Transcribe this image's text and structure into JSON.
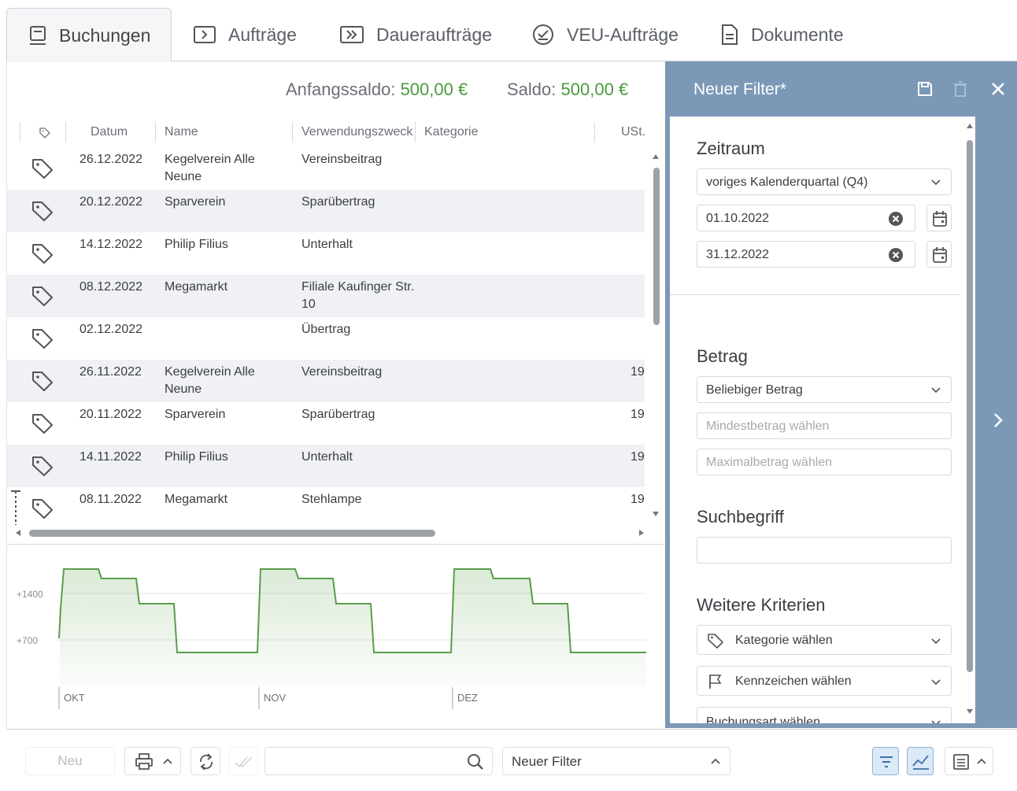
{
  "tabs": [
    {
      "label": "Buchungen",
      "icon": "ledger-icon",
      "active": true
    },
    {
      "label": "Aufträge",
      "icon": "transfer-icon",
      "active": false
    },
    {
      "label": "Daueraufträge",
      "icon": "standing-order-icon",
      "active": false
    },
    {
      "label": "VEU-Aufträge",
      "icon": "check-circle-icon",
      "active": false
    },
    {
      "label": "Dokumente",
      "icon": "document-icon",
      "active": false
    }
  ],
  "saldo": {
    "start_label": "Anfangssaldo:",
    "start_value": "500,00 €",
    "balance_label": "Saldo:",
    "balance_value": "500,00 €"
  },
  "table": {
    "columns": [
      "Datum",
      "Name",
      "Verwendungszweck",
      "Kategorie",
      "USt."
    ],
    "rows": [
      {
        "date": "26.12.2022",
        "name": "Kegelverein Alle Neune",
        "purpose": "Vereinsbeitrag",
        "ust": ""
      },
      {
        "date": "20.12.2022",
        "name": "Sparverein",
        "purpose": "Sparübertrag",
        "ust": ""
      },
      {
        "date": "14.12.2022",
        "name": "Philip Filius",
        "purpose": "Unterhalt",
        "ust": ""
      },
      {
        "date": "08.12.2022",
        "name": "Megamarkt",
        "purpose": "Filiale Kaufinger Str. 10",
        "ust": ""
      },
      {
        "date": "02.12.2022",
        "name": "",
        "purpose": "Übertrag",
        "ust": ""
      },
      {
        "date": "26.11.2022",
        "name": "Kegelverein Alle Neune",
        "purpose": "Vereinsbeitrag",
        "ust": "19"
      },
      {
        "date": "20.11.2022",
        "name": "Sparverein",
        "purpose": "Sparübertrag",
        "ust": "19"
      },
      {
        "date": "14.11.2022",
        "name": "Philip Filius",
        "purpose": "Unterhalt",
        "ust": "19"
      },
      {
        "date": "08.11.2022",
        "name": "Megamarkt",
        "purpose": "Stehlampe",
        "ust": "19"
      }
    ]
  },
  "chart_data": {
    "type": "area",
    "y_ticks": [
      "+1400",
      "+700"
    ],
    "x_ticks": [
      "OKT",
      "NOV",
      "DEZ"
    ],
    "series_color": "#5a9e4b"
  },
  "filter_panel": {
    "title": "Neuer Filter*",
    "sections": {
      "zeitraum": {
        "title": "Zeitraum",
        "period": "voriges Kalenderquartal (Q4)",
        "from": "01.10.2022",
        "to": "31.12.2022"
      },
      "betrag": {
        "title": "Betrag",
        "mode": "Beliebiger Betrag",
        "min_placeholder": "Mindestbetrag wählen",
        "max_placeholder": "Maximalbetrag wählen"
      },
      "suchbegriff": {
        "title": "Suchbegriff",
        "value": ""
      },
      "weitere": {
        "title": "Weitere Kriterien",
        "category": "Kategorie wählen",
        "flag": "Kennzeichen wählen",
        "booking_type": "Buchungsart wählen"
      }
    }
  },
  "toolbar": {
    "new_label": "Neu",
    "search_value": "",
    "filter_select": "Neuer Filter"
  },
  "colors": {
    "panel": "#7b98b6",
    "positive": "#4a9a3c",
    "chart_line": "#5a9e4b"
  }
}
